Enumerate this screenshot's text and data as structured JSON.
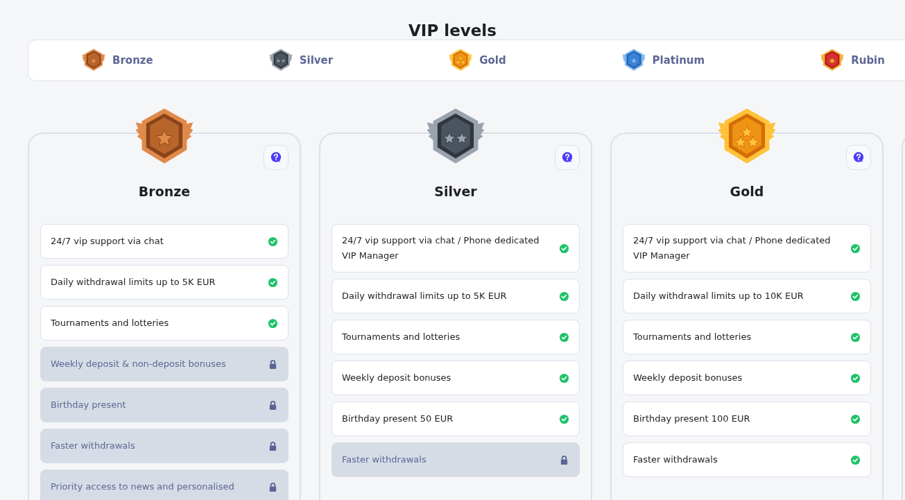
{
  "page_title": "VIP levels",
  "level_tabs": [
    {
      "label": "Bronze",
      "kind": "bronze"
    },
    {
      "label": "Silver",
      "kind": "silver"
    },
    {
      "label": "Gold",
      "kind": "gold"
    },
    {
      "label": "Platinum",
      "kind": "platinum"
    },
    {
      "label": "Rubin",
      "kind": "rubin"
    }
  ],
  "cards": [
    {
      "title": "Bronze",
      "kind": "bronze",
      "benefits": [
        {
          "text": "24/7 vip support via chat",
          "unlocked": true
        },
        {
          "text": "Daily withdrawal limits up to 5K EUR",
          "unlocked": true
        },
        {
          "text": "Tournaments and lotteries",
          "unlocked": true
        },
        {
          "text": "Weekly deposit & non-deposit bonuses",
          "unlocked": false
        },
        {
          "text": "Birthday present",
          "unlocked": false
        },
        {
          "text": "Faster withdrawals",
          "unlocked": false
        },
        {
          "text": "Priority access to news and personalised",
          "unlocked": false
        }
      ]
    },
    {
      "title": "Silver",
      "kind": "silver",
      "benefits": [
        {
          "text": "24/7 vip support via chat / Phone dedicated VIP Manager",
          "unlocked": true
        },
        {
          "text": "Daily withdrawal limits up to 5K EUR",
          "unlocked": true
        },
        {
          "text": "Tournaments and lotteries",
          "unlocked": true
        },
        {
          "text": "Weekly deposit bonuses",
          "unlocked": true
        },
        {
          "text": "Birthday present 50 EUR",
          "unlocked": true
        },
        {
          "text": "Faster withdrawals",
          "unlocked": false
        }
      ]
    },
    {
      "title": "Gold",
      "kind": "gold",
      "benefits": [
        {
          "text": "24/7 vip support via chat / Phone dedicated VIP Manager",
          "unlocked": true
        },
        {
          "text": "Daily withdrawal limits up to 10K EUR",
          "unlocked": true
        },
        {
          "text": "Tournaments and lotteries",
          "unlocked": true
        },
        {
          "text": "Weekly deposit bonuses",
          "unlocked": true
        },
        {
          "text": "Birthday present 100 EUR",
          "unlocked": true
        },
        {
          "text": "Faster withdrawals",
          "unlocked": true
        }
      ]
    }
  ]
}
